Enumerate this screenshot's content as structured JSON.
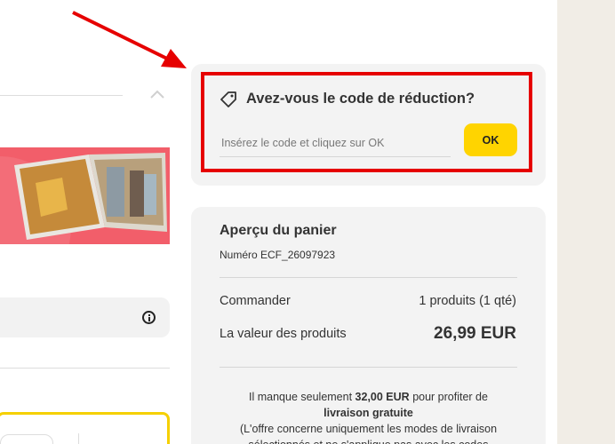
{
  "discount": {
    "title": "Avez-vous le code de réduction?",
    "placeholder": "Insérez le code et cliquez sur OK",
    "ok_label": "OK"
  },
  "cart": {
    "title": "Aperçu du panier",
    "number": "Numéro ECF_26097923",
    "order_label": "Commander",
    "order_value": "1 produits (1 qté)",
    "products_label": "La valeur des produits",
    "products_value": "26,99 EUR",
    "shipping_prefix": "Il manque seulement",
    "shipping_amount": "32,00 EUR",
    "shipping_suffix": "pour profiter de",
    "shipping_free": "livraison gratuite",
    "shipping_condition": "(L'offre concerne uniquement les modes de livraison sélectionnés et ne s'applique pas avec les codes"
  },
  "colors": {
    "accent_yellow": "#ffd400",
    "highlight_red": "#e60000",
    "card_bg": "#f3f3f3",
    "page_side": "#f1ede6"
  },
  "icons": {
    "discount": "tag-icon",
    "info": "info-icon",
    "collapse": "chevron-up-icon"
  }
}
